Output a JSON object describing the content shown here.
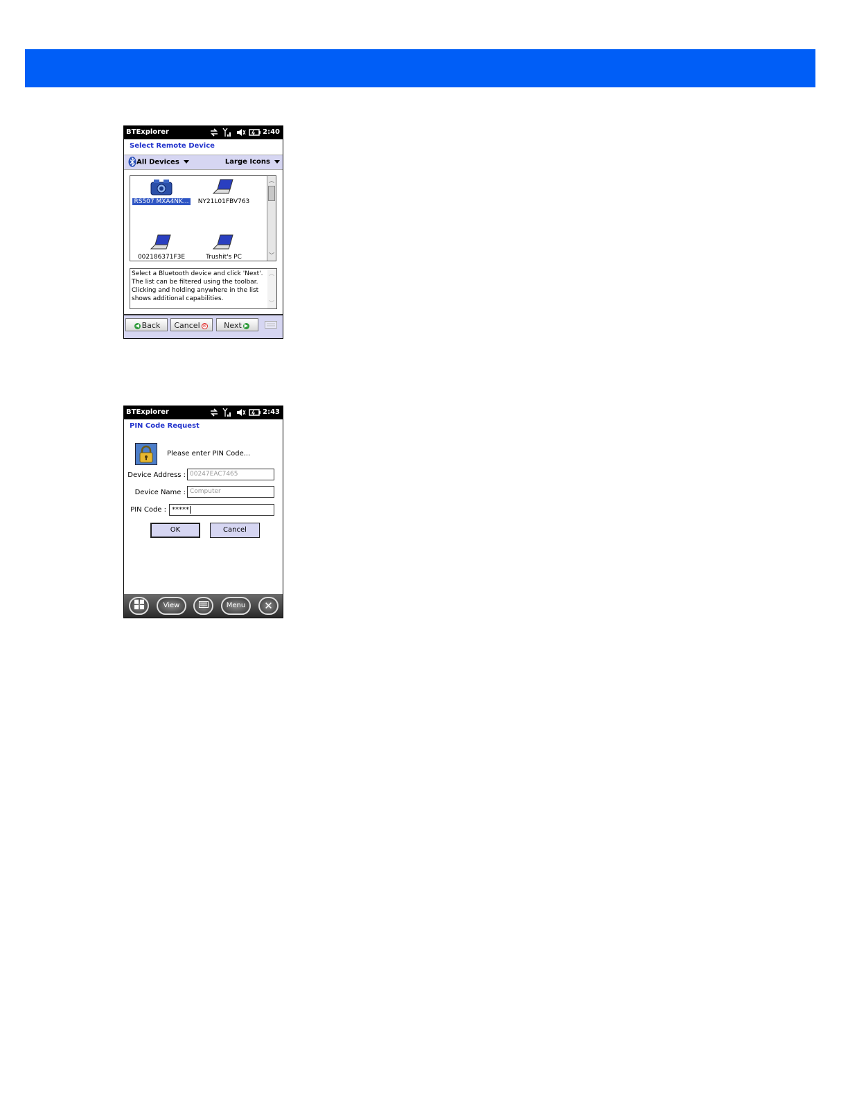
{
  "screen1": {
    "status": {
      "title": "BTExplorer",
      "time": "2:40"
    },
    "heading": "Select Remote Device",
    "filter": {
      "devices": "All Devices",
      "view": "Large Icons"
    },
    "devices": [
      {
        "name": "RS507 MXA4NK...",
        "icon": "scanner-icon",
        "selected": true
      },
      {
        "name": "NY21L01FBV763",
        "icon": "laptop-icon",
        "selected": false
      },
      {
        "name": "002186371F3E",
        "icon": "laptop-icon",
        "selected": false
      },
      {
        "name": "Trushit's PC",
        "icon": "laptop-icon",
        "selected": false
      }
    ],
    "help_lines": [
      "Select a Bluetooth device and click 'Next'.",
      "The list can be filtered using the toolbar.",
      "Clicking and holding anywhere in the list",
      "shows additional capabilities."
    ],
    "buttons": {
      "back": "Back",
      "cancel": "Cancel",
      "next": "Next"
    }
  },
  "screen2": {
    "status": {
      "title": "BTExplorer",
      "time": "2:43"
    },
    "heading": "PIN Code Request",
    "prompt": "Please enter PIN Code...",
    "fields": {
      "address_label": "Device Address :",
      "address_value": "00247EAC7465",
      "name_label": "Device Name :",
      "name_value": "Computer",
      "pin_label": "PIN Code :",
      "pin_value": "*****"
    },
    "buttons": {
      "ok": "OK",
      "cancel": "Cancel"
    },
    "taskbar": {
      "view": "View",
      "menu": "Menu"
    }
  },
  "colors": {
    "banner": "#005ef7",
    "heading": "#2233cc",
    "toolbar": "#d6d6f2",
    "selection": "#2e55c4"
  }
}
